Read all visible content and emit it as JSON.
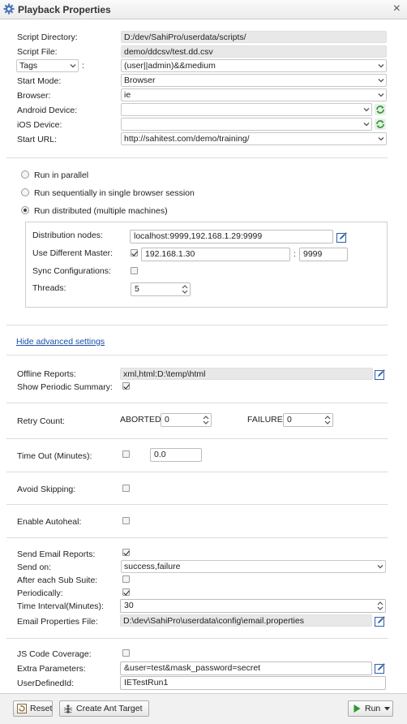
{
  "window": {
    "title": "Playback Properties"
  },
  "script": {
    "directory_label": "Script Directory:",
    "directory": "D:/dev/SahiPro/userdata/scripts/",
    "file_label": "Script File:",
    "file": "demo/ddcsv/test.dd.csv",
    "tags_select": "Tags",
    "tags_colon": ":",
    "tags_value": "(user||admin)&&medium",
    "start_mode_label": "Start Mode:",
    "start_mode": "Browser",
    "browser_label": "Browser:",
    "browser": "ie",
    "android_label": "Android Device:",
    "android": "",
    "ios_label": "iOS Device:",
    "ios": "",
    "start_url_label": "Start URL:",
    "start_url": "http://sahitest.com/demo/training/"
  },
  "run_options": {
    "parallel": "Run in parallel",
    "sequential": "Run sequentially in single browser session",
    "distributed": "Run distributed (multiple machines)",
    "selected": "distributed"
  },
  "distributed": {
    "nodes_label": "Distribution nodes:",
    "nodes": "localhost:9999,192.168.1.29:9999",
    "master_label": "Use Different Master:",
    "master_checked": true,
    "master_host": "192.168.1.30",
    "master_colon": ":",
    "master_port": "9999",
    "sync_label": "Sync Configurations:",
    "sync_checked": false,
    "threads_label": "Threads:",
    "threads": "5"
  },
  "advanced_link": "Hide advanced settings",
  "reports": {
    "offline_label": "Offline Reports:",
    "offline": "xml,html:D:\\temp\\html",
    "periodic_label": "Show Periodic Summary:",
    "periodic_checked": true
  },
  "retry": {
    "label": "Retry Count:",
    "aborted_label": "ABORTED",
    "aborted": "0",
    "failure_label": "FAILURE",
    "failure": "0"
  },
  "timeout": {
    "label": "Time Out (Minutes):",
    "checked": false,
    "value": "0.0"
  },
  "avoid_skipping": {
    "label": "Avoid Skipping:",
    "checked": false
  },
  "autoheal": {
    "label": "Enable Autoheal:",
    "checked": false
  },
  "email": {
    "send_label": "Send Email Reports:",
    "send_checked": true,
    "send_on_label": "Send on:",
    "send_on": "success,failure",
    "sub_suite_label": "After each Sub Suite:",
    "sub_suite_checked": false,
    "periodically_label": "Periodically:",
    "periodically_checked": true,
    "interval_label": "Time Interval(Minutes):",
    "interval": "30",
    "props_label": "Email Properties File:",
    "props": "D:\\dev\\SahiPro\\userdata\\config\\email.properties"
  },
  "coverage": {
    "label": "JS Code Coverage:",
    "checked": false
  },
  "extra": {
    "label": "Extra Parameters:",
    "value": "&user=test&mask_password=secret"
  },
  "user_defined": {
    "label": "UserDefinedId:",
    "value": "IETestRun1"
  },
  "footer": {
    "reset": "Reset",
    "ant": "Create Ant Target",
    "run": "Run"
  },
  "colors": {
    "link": "#1a4fa8",
    "run_icon": "#2e9a2e",
    "refresh_icon": "#3a9a3a",
    "edit_icon": "#2a5db0"
  }
}
